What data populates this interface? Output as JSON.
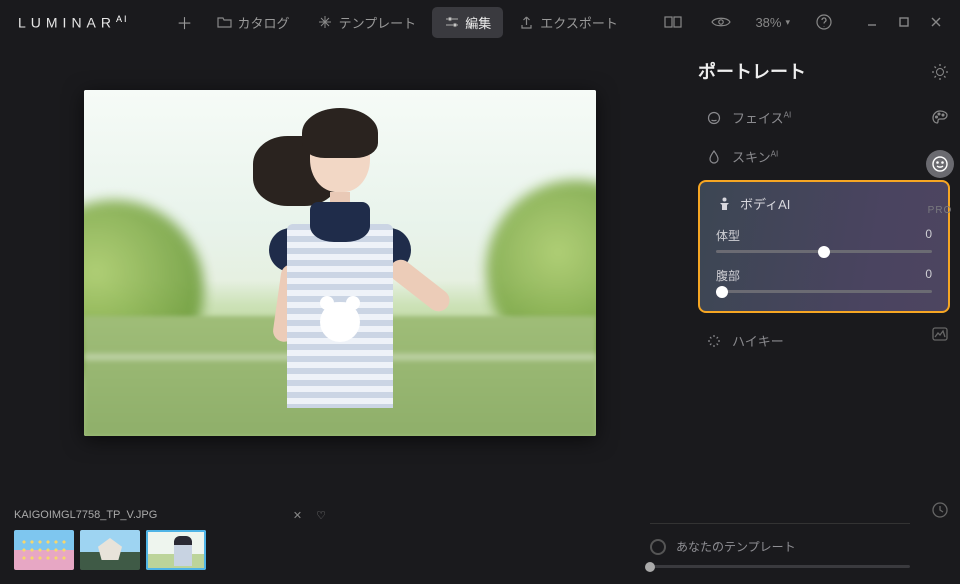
{
  "app_name": "LUMINAR",
  "app_suffix": "AI",
  "nav": {
    "catalog": "カタログ",
    "template": "テンプレート",
    "edit": "編集",
    "export": "エクスポート"
  },
  "zoom": "38%",
  "panel": {
    "title": "ポートレート",
    "face": "フェイス",
    "skin": "スキン",
    "body": "ボディ",
    "highkey": "ハイキー",
    "ai_suffix": "AI"
  },
  "sliders": {
    "body_shape": {
      "label": "体型",
      "value": 0,
      "pos": 50
    },
    "abdomen": {
      "label": "腹部",
      "value": 0,
      "pos": 3
    }
  },
  "rail": {
    "pro": "PRO"
  },
  "file": {
    "name": "KAIGOIMGL7758_TP_V.JPG"
  },
  "your_template": "あなたのテンプレート"
}
